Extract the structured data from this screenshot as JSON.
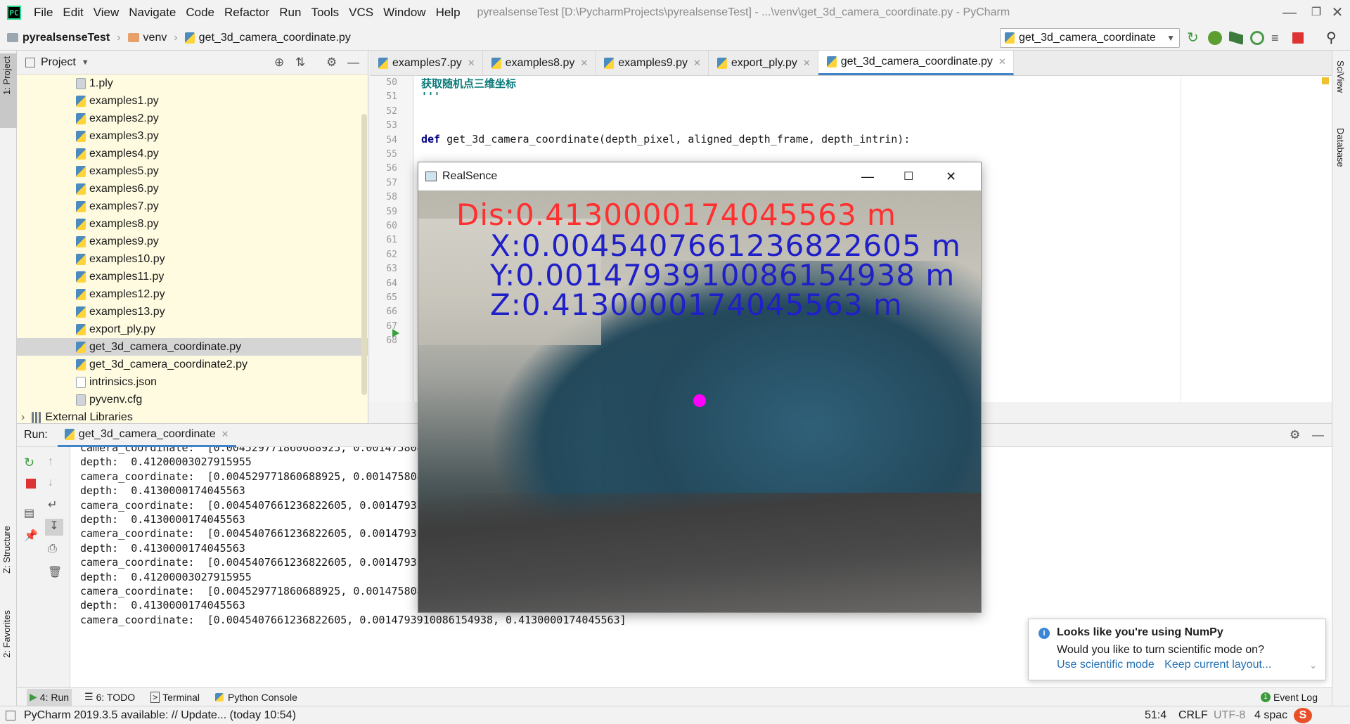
{
  "app": {
    "logo_text": "PC",
    "menu": [
      "File",
      "Edit",
      "View",
      "Navigate",
      "Code",
      "Refactor",
      "Run",
      "Tools",
      "VCS",
      "Window",
      "Help"
    ],
    "window_title": "pyrealsenseTest [D:\\PycharmProjects\\pyrealsenseTest] - ...\\venv\\get_3d_camera_coordinate.py - PyCharm"
  },
  "navbar": {
    "breadcrumbs": [
      "pyrealsenseTest",
      "venv",
      "get_3d_camera_coordinate.py"
    ],
    "run_config": "get_3d_camera_coordinate"
  },
  "side_tabs": {
    "left": [
      "1: Project",
      "Z: Structure",
      "2: Favorites"
    ],
    "right": [
      "SciView",
      "Database"
    ]
  },
  "project": {
    "title": "Project",
    "files": [
      {
        "name": "1.ply",
        "type": "file"
      },
      {
        "name": "examples1.py",
        "type": "py"
      },
      {
        "name": "examples2.py",
        "type": "py"
      },
      {
        "name": "examples3.py",
        "type": "py"
      },
      {
        "name": "examples4.py",
        "type": "py"
      },
      {
        "name": "examples5.py",
        "type": "py"
      },
      {
        "name": "examples6.py",
        "type": "py"
      },
      {
        "name": "examples7.py",
        "type": "py"
      },
      {
        "name": "examples8.py",
        "type": "py"
      },
      {
        "name": "examples9.py",
        "type": "py"
      },
      {
        "name": "examples10.py",
        "type": "py"
      },
      {
        "name": "examples11.py",
        "type": "py"
      },
      {
        "name": "examples12.py",
        "type": "py"
      },
      {
        "name": "examples13.py",
        "type": "py"
      },
      {
        "name": "export_ply.py",
        "type": "py"
      },
      {
        "name": "get_3d_camera_coordinate.py",
        "type": "py",
        "selected": true
      },
      {
        "name": "get_3d_camera_coordinate2.py",
        "type": "py"
      },
      {
        "name": "intrinsics.json",
        "type": "json"
      },
      {
        "name": "pyvenv.cfg",
        "type": "file"
      }
    ],
    "external_libraries": "External Libraries"
  },
  "editor": {
    "tabs": [
      "examples7.py",
      "examples8.py",
      "examples9.py",
      "export_ply.py",
      "get_3d_camera_coordinate.py"
    ],
    "active_tab": 4,
    "line_numbers": [
      "50",
      "51",
      "52",
      "53",
      "54",
      "55",
      "56",
      "57",
      "58",
      "59",
      "60",
      "61",
      "62",
      "63",
      "64",
      "65",
      "66",
      "67",
      "68"
    ],
    "code": {
      "line50": "获取随机点三维坐标",
      "line51": "'''",
      "line54_kw": "def",
      "line54_rest": " get_3d_camera_coordinate(depth_pixel, aligned_depth_frame, depth_intrin):"
    }
  },
  "run": {
    "label": "Run:",
    "tab": "get_3d_camera_coordinate",
    "console_lines": [
      "camera_coordinate:  [0.004529771860688925, 0.0014758089",
      "depth:  0.41200003027915955",
      "camera_coordinate:  [0.004529771860688925, 0.001475808",
      "depth:  0.4130000174045563",
      "camera_coordinate:  [0.0045407661236822605, 0.0014793",
      "depth:  0.4130000174045563",
      "camera_coordinate:  [0.0045407661236822605, 0.0014793",
      "depth:  0.4130000174045563",
      "camera_coordinate:  [0.0045407661236822605, 0.0014793",
      "depth:  0.41200003027915955",
      "camera_coordinate:  [0.004529771860688925, 0.001475808909162879, 0.41200003027915955]",
      "depth:  0.4130000174045563",
      "camera_coordinate:  [0.0045407661236822605, 0.0014793910086154938, 0.4130000174045563]"
    ]
  },
  "realsense_window": {
    "title": "RealSence",
    "overlay": {
      "dis": "Dis:0.4130000174045563  m",
      "x": "X:0.0045407661236822605  m",
      "y": "Y:0.0014793910086154938  m",
      "z": "Z:0.4130000174045563  m"
    },
    "colors": {
      "dis": "#ff3030",
      "xyz": "#2020c8",
      "marker": "#ff00ff"
    }
  },
  "notification": {
    "title": "Looks like you're using NumPy",
    "body": "Would you like to turn scientific mode on?",
    "link1": "Use scientific mode",
    "link2": "Keep current layout..."
  },
  "bottom_tools": [
    "4: Run",
    "6: TODO",
    "Terminal",
    "Python Console"
  ],
  "event_log": "Event Log",
  "status": {
    "message": "PyCharm 2019.3.5 available: // Update... (today 10:54)",
    "position": "51:4",
    "line_sep": "CRLF",
    "encoding": "UTF-8",
    "indent": "4 spac"
  }
}
